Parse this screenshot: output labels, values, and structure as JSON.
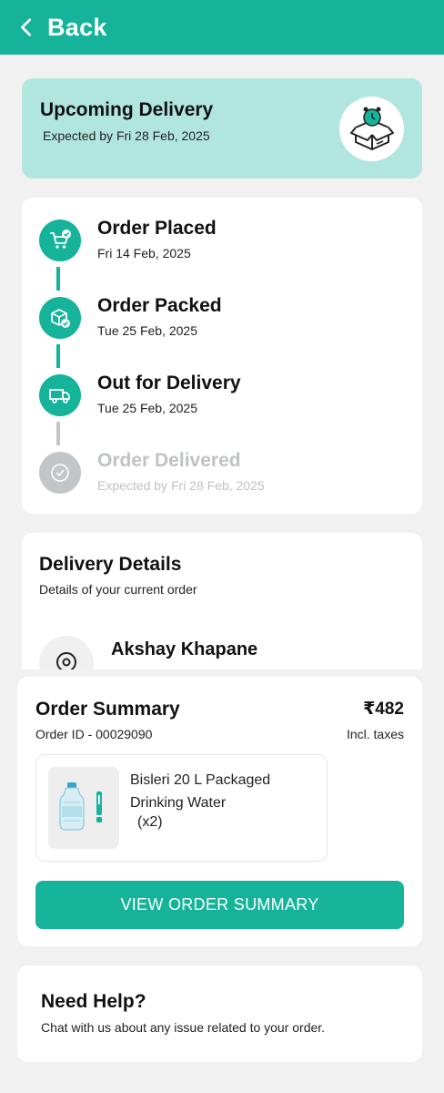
{
  "header": {
    "back_label": "Back"
  },
  "upcoming": {
    "title": "Upcoming Delivery",
    "expected": "Expected by Fri 28 Feb, 2025"
  },
  "timeline": [
    {
      "title": "Order Placed",
      "date": "Fri 14 Feb, 2025",
      "icon": "cart-icon",
      "status": "done"
    },
    {
      "title": "Order Packed",
      "date": "Tue 25 Feb, 2025",
      "icon": "package-icon",
      "status": "done"
    },
    {
      "title": "Out for Delivery",
      "date": "Tue 25 Feb, 2025",
      "icon": "truck-icon",
      "status": "done"
    },
    {
      "title": "Order Delivered",
      "date": "Expected by Fri 28 Feb, 2025",
      "icon": "check-circle-icon",
      "status": "pending"
    }
  ],
  "delivery_details": {
    "title": "Delivery Details",
    "subtitle": "Details of your current order",
    "customer_name": "Akshay Khapane"
  },
  "order_summary": {
    "title": "Order Summary",
    "price": "₹482",
    "order_id": "Order ID - 00029090",
    "tax_note": "Incl. taxes",
    "product_name": "Bisleri 20 L Packaged Drinking Water",
    "product_qty": "(x2)",
    "button_label": "VIEW ORDER SUMMARY"
  },
  "help": {
    "title": "Need Help?",
    "subtitle": "Chat with us about any issue related to your order."
  },
  "colors": {
    "accent": "#14b39a",
    "accent_light": "#b1e6df",
    "pending": "#c3c6c8"
  }
}
